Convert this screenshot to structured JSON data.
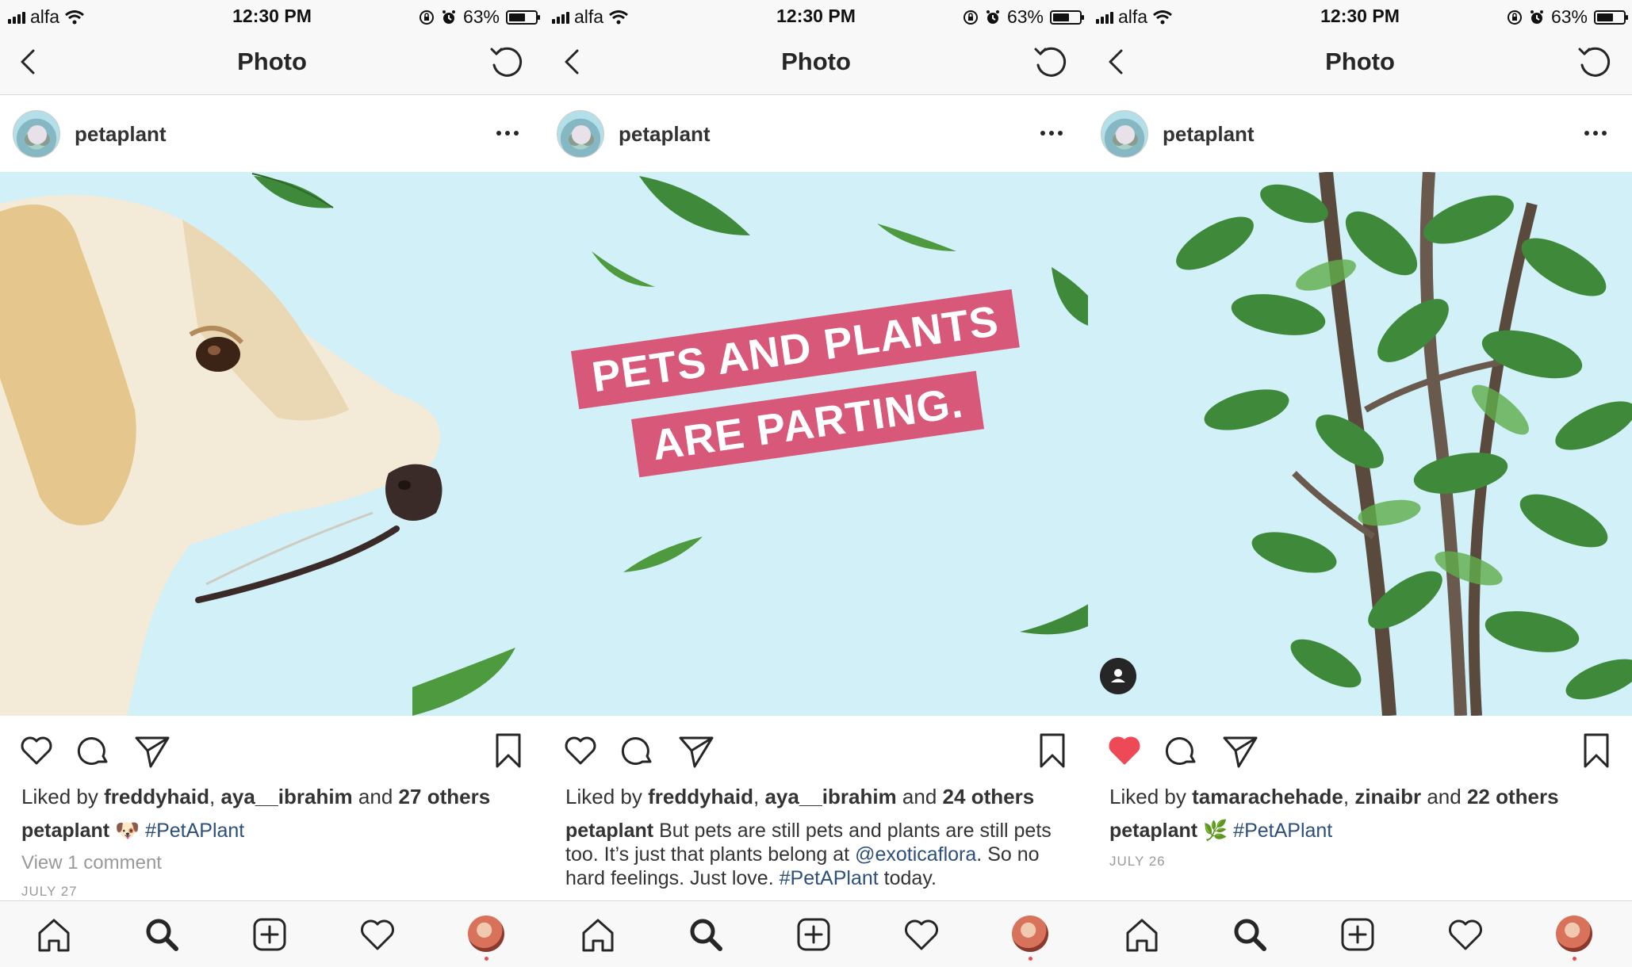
{
  "status_bar": {
    "carrier": "alfa",
    "time": "12:30 PM",
    "battery": "63%",
    "battery_level": 0.63
  },
  "nav": {
    "title": "Photo"
  },
  "posts": [
    {
      "username": "petaplant",
      "liked_by_prefix": "Liked by",
      "liked_user_1": "freddyhaid",
      "liked_user_2": "aya__ibrahim",
      "and_word": "and",
      "others": "27 others",
      "caption_emoji": "🐶",
      "caption_text": "",
      "hashtag": "#PetAPlant",
      "view_comments": "View 1 comment",
      "date": "JULY 27",
      "liked": false
    },
    {
      "username": "petaplant",
      "liked_by_prefix": "Liked by",
      "liked_user_1": "freddyhaid",
      "liked_user_2": "aya__ibrahim",
      "and_word": "and",
      "others": "24 others",
      "banner_line_1": "PETS AND PLANTS",
      "banner_line_2": "ARE PARTING.",
      "caption_part_1": "But pets are still pets and plants are still pets too. It’s just that plants belong at",
      "mention": "@exoticaflora",
      "caption_part_2": ". So no hard feelings. Just love.",
      "hashtag": "#PetAPlant",
      "caption_part_3": "today.",
      "liked": false
    },
    {
      "username": "petaplant",
      "liked_by_prefix": "Liked by",
      "liked_user_1": "tamarachehade",
      "liked_user_2": "zinaibr",
      "and_word": "and",
      "others": "22 others",
      "caption_emoji": "🌿",
      "hashtag": "#PetAPlant",
      "date": "JULY 26",
      "liked": true
    }
  ],
  "colors": {
    "like_red": "#ed4956",
    "hashtag_blue": "#2d4f7c",
    "banner_pink": "#d8587a",
    "photo_bg": "#d2f0f7",
    "leaf_green": "#3f8a3a"
  }
}
